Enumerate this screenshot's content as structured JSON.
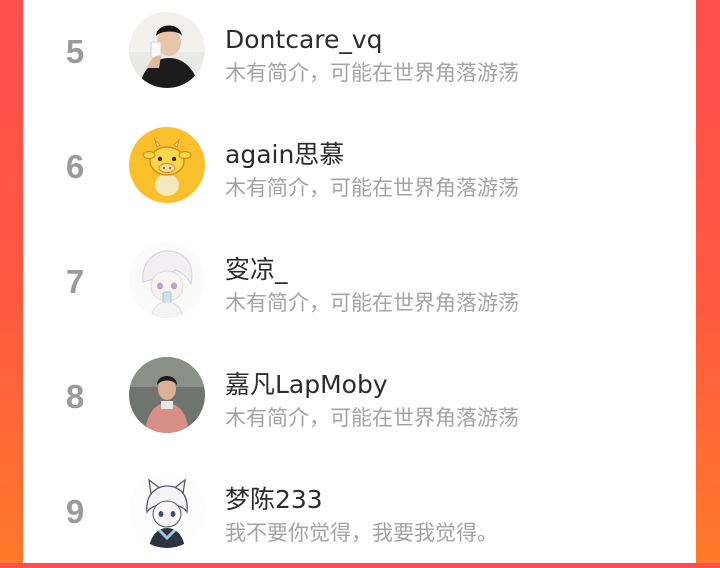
{
  "users": [
    {
      "rank": "5",
      "name": "Dontcare_vq",
      "bio": "木有简介，可能在世界角落游荡",
      "avatar": "man-drinking-photo-avatar"
    },
    {
      "rank": "6",
      "name": "again思慕",
      "bio": "木有简介，可能在世界角落游荡",
      "avatar": "cartoon-cow-avatar"
    },
    {
      "rank": "7",
      "name": "叜凉_",
      "bio": "木有简介，可能在世界角落游荡",
      "avatar": "anime-boy-sketch-avatar"
    },
    {
      "rank": "8",
      "name": "嘉凡LapMoby",
      "bio": "木有简介，可能在世界角落游荡",
      "avatar": "man-pink-sweater-photo-avatar"
    },
    {
      "rank": "9",
      "name": "梦陈233",
      "bio": "我不要你觉得，我要我觉得。",
      "avatar": "anime-cat-boy-avatar"
    }
  ],
  "colors": {
    "background_top": "#ff4f4f",
    "background_bottom": "#ff7a2a",
    "rank": "#9b9b9b",
    "name": "#2c2c2c",
    "bio": "#a4a4a4"
  }
}
